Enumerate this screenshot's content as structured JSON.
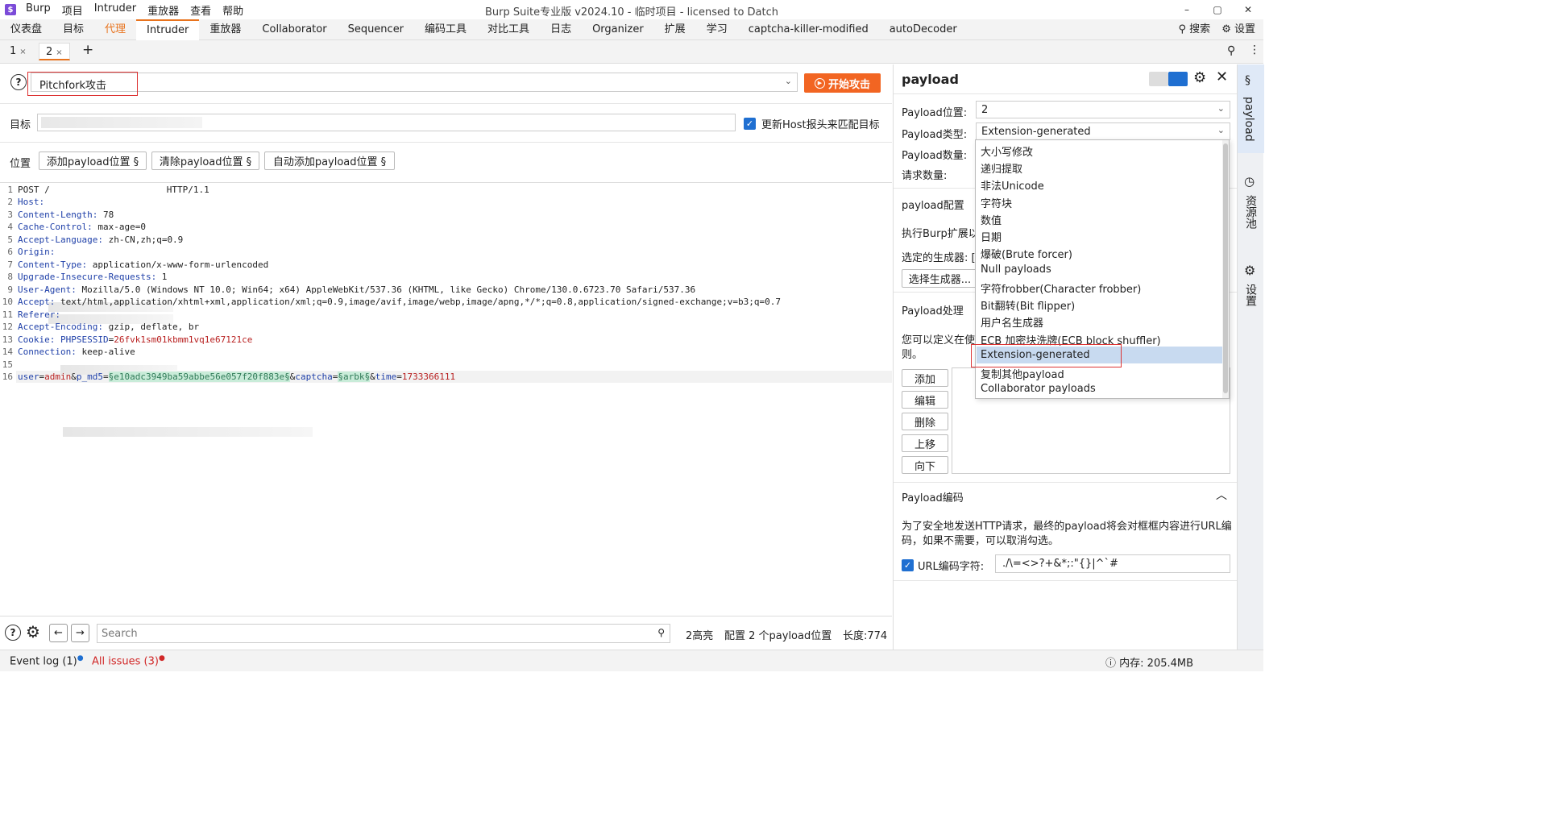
{
  "app": {
    "logo": "$",
    "menu": [
      "Burp",
      "项目",
      "Intruder",
      "重放器",
      "查看",
      "帮助"
    ],
    "title": "Burp Suite专业版  v2024.10 - 临时项目 - licensed to Datch",
    "window_buttons": [
      "–",
      "▢",
      "✕"
    ]
  },
  "main_tabs": [
    "仪表盘",
    "目标",
    "代理",
    "Intruder",
    "重放器",
    "Collaborator",
    "Sequencer",
    "编码工具",
    "对比工具",
    "日志",
    "Organizer",
    "扩展",
    "学习",
    "captcha-killer-modified",
    "autoDecoder"
  ],
  "main_tabs_active": "Intruder",
  "main_tabs_highlight": "代理",
  "toolbar_right": {
    "search": "搜索",
    "settings": "设置"
  },
  "sub_tabs": [
    {
      "label": "1",
      "close": "×"
    },
    {
      "label": "2",
      "close": "×"
    }
  ],
  "sub_tabs_add": "+",
  "attack": {
    "help": "?",
    "type": "Pitchfork攻击",
    "start_button": "开始攻击"
  },
  "target": {
    "label": "目标",
    "host_check": "更新Host报头来匹配目标"
  },
  "positions": {
    "label": "位置",
    "add": "添加payload位置 §",
    "clear": "清除payload位置 §",
    "auto": "自动添加payload位置 §"
  },
  "request": [
    {
      "n": "1",
      "k": "POST /",
      "v": "HTTP/1.1"
    },
    {
      "n": "2",
      "k": "Host:",
      "v": ""
    },
    {
      "n": "3",
      "k": "Content-Length:",
      "v": " 78"
    },
    {
      "n": "4",
      "k": "Cache-Control:",
      "v": " max-age=0"
    },
    {
      "n": "5",
      "k": "Accept-Language:",
      "v": " zh-CN,zh;q=0.9"
    },
    {
      "n": "6",
      "k": "Origin:",
      "v": ""
    },
    {
      "n": "7",
      "k": "Content-Type:",
      "v": " application/x-www-form-urlencoded"
    },
    {
      "n": "8",
      "k": "Upgrade-Insecure-Requests:",
      "v": " 1"
    },
    {
      "n": "9",
      "k": "User-Agent:",
      "v": " Mozilla/5.0 (Windows NT 10.0; Win64; x64) AppleWebKit/537.36 (KHTML, like Gecko) Chrome/130.0.6723.70 Safari/537.36"
    },
    {
      "n": "10",
      "k": "Accept:",
      "v": " text/html,application/xhtml+xml,application/xml;q=0.9,image/avif,image/webp,image/apng,*/*;q=0.8,application/signed-exchange;v=b3;q=0.7"
    },
    {
      "n": "11",
      "k": "Referer:",
      "v": ""
    },
    {
      "n": "12",
      "k": "Accept-Encoding:",
      "v": " gzip, deflate, br"
    },
    {
      "n": "13",
      "k": "Cookie:",
      "v": ""
    },
    {
      "n": "14",
      "k": "Connection:",
      "v": " keep-alive"
    },
    {
      "n": "15",
      "k": "",
      "v": ""
    },
    {
      "n": "16",
      "k": "",
      "v": ""
    }
  ],
  "cookie": {
    "name": " PHPSESSID",
    "eq": "=",
    "value": "26fvk1sm01kbmm1vq1e67121ce"
  },
  "body": {
    "p1k": "user",
    "p1v": "admin",
    "amp1": "&",
    "p2k": "p_md5",
    "eq": "=",
    "m2": "§e10adc3949ba59abbe56e057f20f883e§",
    "amp2": "&",
    "p3k": "captcha",
    "m3": "§arbk§",
    "amp3": "&",
    "p4k": "time",
    "p4v": "1733366111"
  },
  "bottom": {
    "search_placeholder": "Search",
    "highlights": "2高亮",
    "config": "配置 2 个payload位置",
    "length": "长度:774"
  },
  "payload_panel": {
    "title": "payload",
    "position_label": "Payload位置:",
    "position_value": "2",
    "type_label": "Payload类型:",
    "type_value": "Extension-generated",
    "count_label": "Payload数量:",
    "requests_label": "请求数量:",
    "config_title": "payload配置",
    "exec_text": "执行Burp扩展以",
    "generator_label": "选定的生成器: [",
    "select_generator": "选择生成器...",
    "processing_title": "Payload处理",
    "processing_text1": "您可以定义在使",
    "processing_text2": "则。",
    "buttons": [
      "添加",
      "编辑",
      "删除",
      "上移",
      "向下"
    ],
    "encoding_title": "Payload编码",
    "encoding_text1": "为了安全地发送HTTP请求，最终的payload将会对框框内容进行URL编",
    "encoding_text2": "码，如果不需要，可以取消勾选。",
    "url_encode_label": "URL编码字符:",
    "url_encode_chars": "./\\=<>?+&*;:\"{}|^`#"
  },
  "dropdown_options": [
    "大小写修改",
    "递归提取",
    "非法Unicode",
    "字符块",
    "数值",
    "日期",
    "爆破(Brute forcer)",
    "Null payloads",
    "字符frobber(Character frobber)",
    "Bit翻转(Bit flipper)",
    "用户名生成器",
    "ECB 加密块洗牌(ECB block shuffler)",
    "Extension-generated",
    "复制其他payload",
    "Collaborator payloads"
  ],
  "dropdown_selected": "Extension-generated",
  "side_tabs": [
    "payload",
    "资源池",
    "设置"
  ],
  "status": {
    "event_log": "Event log (1)",
    "issues": "All issues (3)",
    "memory": "内存: 205.4MB"
  },
  "colors": {
    "accent": "#e8731d",
    "start": "#f26522",
    "highlight_box": "#dd3333",
    "check": "#1f6fd1"
  }
}
